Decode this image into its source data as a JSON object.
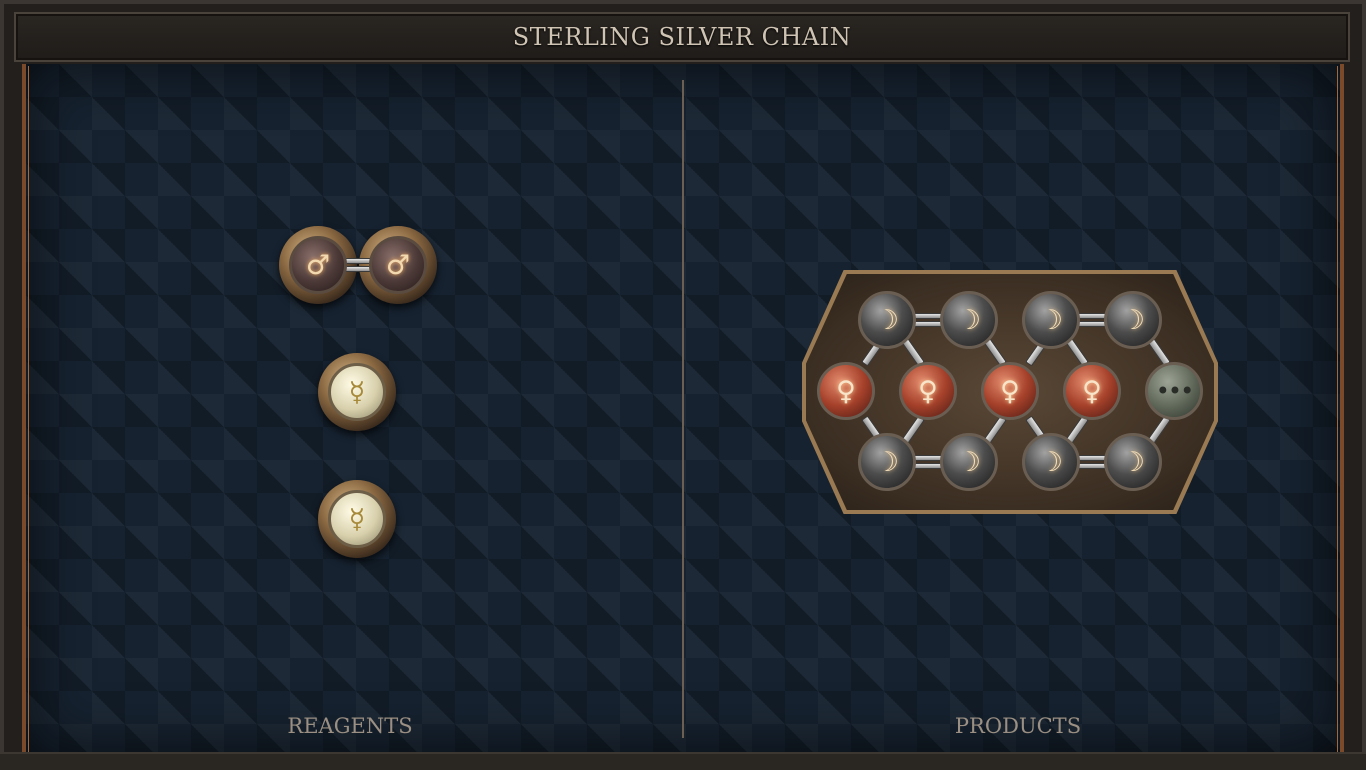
{
  "title": "STERLING SILVER CHAIN",
  "sections": {
    "reagents_label": "REAGENTS",
    "products_label": "PRODUCTS"
  },
  "colors": {
    "board": "#162230",
    "frame": "#231f1c",
    "accent_rim": "#7a4a2a",
    "label_text": "#9a8f82"
  },
  "reagents": [
    {
      "name": "iron-pair",
      "atoms": [
        {
          "element": "iron",
          "glyph": "♂"
        },
        {
          "element": "iron",
          "glyph": "♂"
        }
      ],
      "bond": "single"
    },
    {
      "name": "quicksilver-1",
      "atoms": [
        {
          "element": "quicksilver",
          "glyph": "☿"
        }
      ]
    },
    {
      "name": "quicksilver-2",
      "atoms": [
        {
          "element": "quicksilver",
          "glyph": "☿"
        }
      ]
    }
  ],
  "product": {
    "top_row": [
      {
        "element": "silver",
        "glyph": "☽"
      },
      {
        "element": "silver",
        "glyph": "☽"
      },
      {
        "element": "silver",
        "glyph": "☽"
      },
      {
        "element": "silver",
        "glyph": "☽"
      }
    ],
    "middle_row": [
      {
        "element": "copper",
        "glyph": "♀"
      },
      {
        "element": "copper",
        "glyph": "♀"
      },
      {
        "element": "copper",
        "glyph": "♀"
      },
      {
        "element": "copper",
        "glyph": "♀"
      },
      {
        "element": "repeat",
        "glyph": "•••"
      }
    ],
    "bottom_row": [
      {
        "element": "silver",
        "glyph": "☽"
      },
      {
        "element": "silver",
        "glyph": "☽"
      },
      {
        "element": "silver",
        "glyph": "☽"
      },
      {
        "element": "silver",
        "glyph": "☽"
      }
    ]
  }
}
